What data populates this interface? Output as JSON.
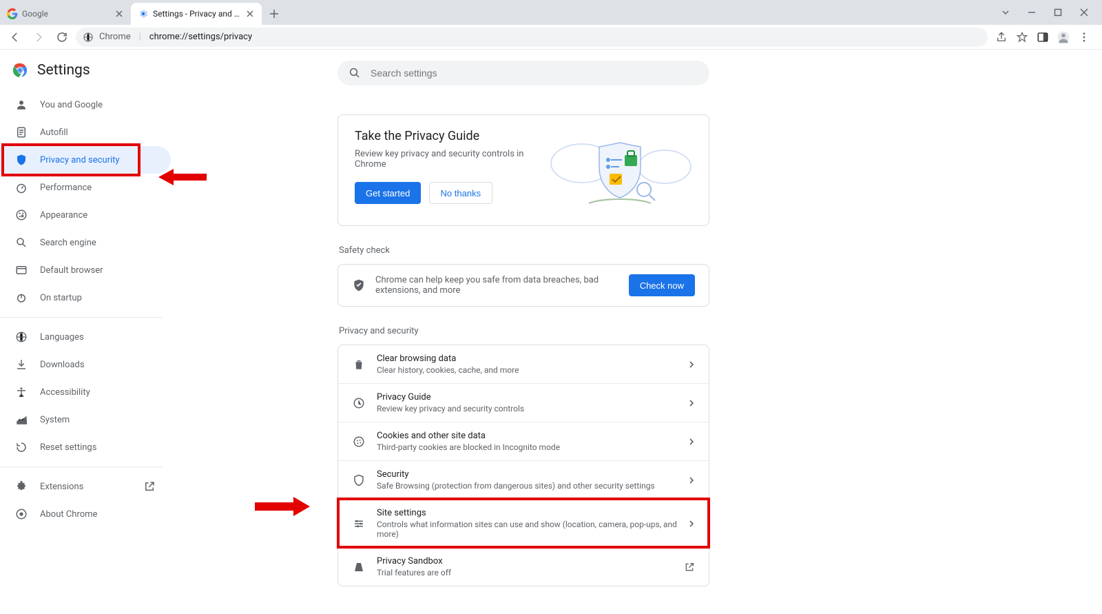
{
  "window": {
    "tabs": [
      {
        "title": "Google",
        "active": false
      },
      {
        "title": "Settings - Privacy and security",
        "active": true
      }
    ]
  },
  "omnibox": {
    "scheme_label": "Chrome",
    "url": "chrome://settings/privacy"
  },
  "brand": {
    "name": "Settings"
  },
  "nav": {
    "primary": [
      {
        "id": "you-and-google",
        "label": "You and Google"
      },
      {
        "id": "autofill",
        "label": "Autofill"
      },
      {
        "id": "privacy-and-security",
        "label": "Privacy and security",
        "active": true
      },
      {
        "id": "performance",
        "label": "Performance"
      },
      {
        "id": "appearance",
        "label": "Appearance"
      },
      {
        "id": "search-engine",
        "label": "Search engine"
      },
      {
        "id": "default-browser",
        "label": "Default browser"
      },
      {
        "id": "on-startup",
        "label": "On startup"
      }
    ],
    "secondary": [
      {
        "id": "languages",
        "label": "Languages"
      },
      {
        "id": "downloads",
        "label": "Downloads"
      },
      {
        "id": "accessibility",
        "label": "Accessibility"
      },
      {
        "id": "system",
        "label": "System"
      },
      {
        "id": "reset-settings",
        "label": "Reset settings"
      }
    ],
    "tertiary": [
      {
        "id": "extensions",
        "label": "Extensions",
        "external": true
      },
      {
        "id": "about-chrome",
        "label": "About Chrome"
      }
    ]
  },
  "search": {
    "placeholder": "Search settings"
  },
  "guide": {
    "title": "Take the Privacy Guide",
    "subtitle": "Review key privacy and security controls in Chrome",
    "primary_btn": "Get started",
    "ghost_btn": "No thanks"
  },
  "safety": {
    "heading": "Safety check",
    "text": "Chrome can help keep you safe from data breaches, bad extensions, and more",
    "btn": "Check now"
  },
  "ps": {
    "heading": "Privacy and security",
    "rows": [
      {
        "id": "clear-browsing-data",
        "title": "Clear browsing data",
        "sub": "Clear history, cookies, cache, and more"
      },
      {
        "id": "privacy-guide",
        "title": "Privacy Guide",
        "sub": "Review key privacy and security controls"
      },
      {
        "id": "cookies",
        "title": "Cookies and other site data",
        "sub": "Third-party cookies are blocked in Incognito mode"
      },
      {
        "id": "security",
        "title": "Security",
        "sub": "Safe Browsing (protection from dangerous sites) and other security settings"
      },
      {
        "id": "site-settings",
        "title": "Site settings",
        "sub": "Controls what information sites can use and show (location, camera, pop-ups, and more)",
        "highlight": true
      },
      {
        "id": "privacy-sandbox",
        "title": "Privacy Sandbox",
        "sub": "Trial features are off",
        "external": true
      }
    ]
  }
}
